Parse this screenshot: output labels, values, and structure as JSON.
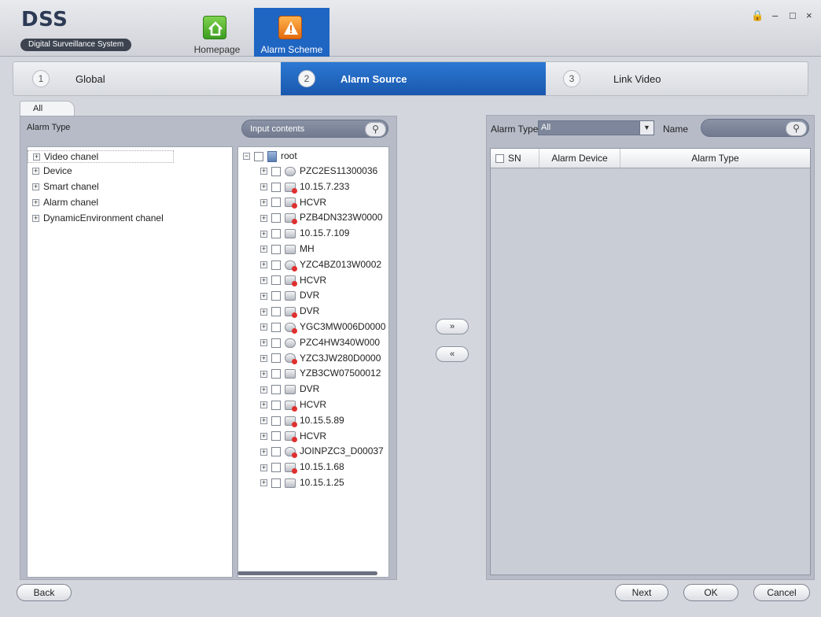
{
  "header": {
    "app_name": "DSS",
    "app_subtitle": "Digital Surveillance System",
    "nav": [
      {
        "label": "Homepage",
        "icon": "home-icon"
      },
      {
        "label": "Alarm Scheme",
        "icon": "alarm-scheme-icon"
      }
    ],
    "window_controls": {
      "lock": "🔒",
      "minimize": "–",
      "maximize": "□",
      "close": "×"
    }
  },
  "steps": [
    {
      "num": "1",
      "label": "Global"
    },
    {
      "num": "2",
      "label": "Alarm Source"
    },
    {
      "num": "3",
      "label": "Link Video"
    }
  ],
  "left": {
    "tab": "All",
    "alarm_type_label": "Alarm Type",
    "search_placeholder": "Input contents",
    "alarm_types": [
      "Video chanel",
      "Device",
      "Smart chanel",
      "Alarm chanel",
      "DynamicEnvironment chanel"
    ],
    "tree_root": "root",
    "devices": [
      {
        "name": "PZC2ES11300036",
        "icon": "camera"
      },
      {
        "name": "10.15.7.233",
        "icon": "device-red"
      },
      {
        "name": "HCVR",
        "icon": "device-red"
      },
      {
        "name": "PZB4DN323W0000",
        "icon": "device-red"
      },
      {
        "name": "10.15.7.109",
        "icon": "device"
      },
      {
        "name": "MH",
        "icon": "device"
      },
      {
        "name": "YZC4BZ013W0002",
        "icon": "camera-red"
      },
      {
        "name": "HCVR",
        "icon": "device-red"
      },
      {
        "name": "DVR",
        "icon": "device"
      },
      {
        "name": "DVR",
        "icon": "device-red"
      },
      {
        "name": "YGC3MW006D0000",
        "icon": "camera-red"
      },
      {
        "name": "PZC4HW340W000",
        "icon": "camera"
      },
      {
        "name": "YZC3JW280D0000",
        "icon": "camera-red"
      },
      {
        "name": "YZB3CW07500012",
        "icon": "device"
      },
      {
        "name": "DVR",
        "icon": "device"
      },
      {
        "name": "HCVR",
        "icon": "device-red"
      },
      {
        "name": "10.15.5.89",
        "icon": "device-red"
      },
      {
        "name": "HCVR",
        "icon": "device-red"
      },
      {
        "name": "JOINPZC3_D00037",
        "icon": "camera-red"
      },
      {
        "name": "10.15.1.68",
        "icon": "device-red"
      },
      {
        "name": "10.15.1.25",
        "icon": "device"
      }
    ]
  },
  "transfer": {
    "add": "»",
    "remove": "«"
  },
  "right": {
    "alarm_type_label": "Alarm Type",
    "alarm_type_value": "All",
    "name_label": "Name",
    "columns": [
      "SN",
      "Alarm Device",
      "Alarm Type"
    ]
  },
  "buttons": {
    "back": "Back",
    "next": "Next",
    "ok": "OK",
    "cancel": "Cancel"
  }
}
